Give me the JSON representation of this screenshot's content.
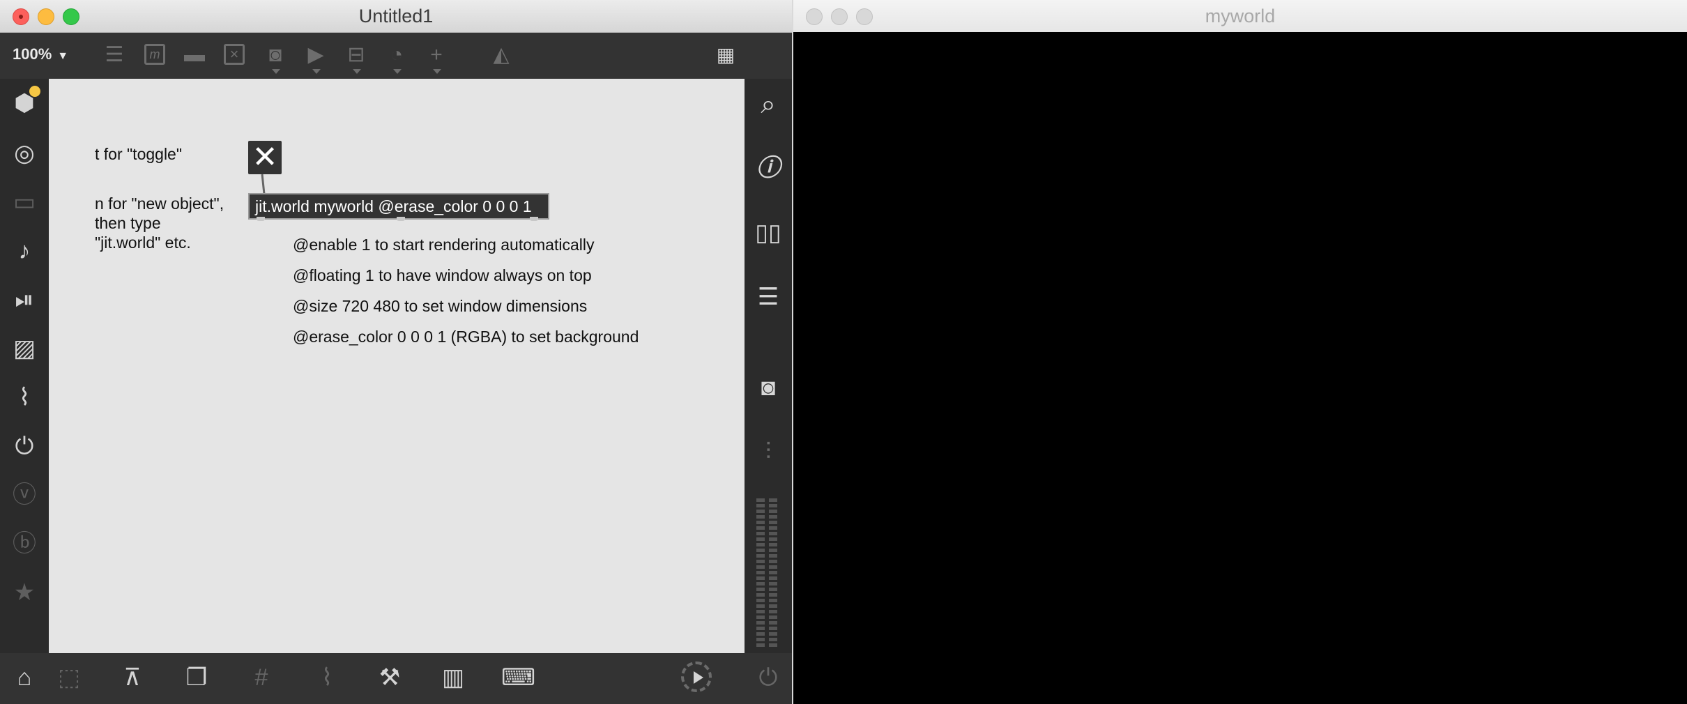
{
  "left_window": {
    "title": "Untitled1",
    "zoom": "100%",
    "canvas": {
      "hint_toggle": "t for \"toggle\"",
      "hint_object": "n for \"new object\",\nthen type\n\"jit.world\" etc.",
      "toggle_glyph": "✕",
      "object_text": "jit.world myworld @erase_color 0 0 0 1",
      "comments": [
        "@enable 1 to start rendering automatically",
        "@floating 1 to have window always on top",
        "@size 720 480 to set window dimensions",
        "@erase_color 0 0 0 1 (RGBA) to set background"
      ]
    }
  },
  "right_window": {
    "title": "myworld",
    "background": "#000000"
  },
  "colors": {
    "canvas": "#e5e5e5",
    "object_box": "#333333",
    "chrome": "#2b2b2b"
  }
}
